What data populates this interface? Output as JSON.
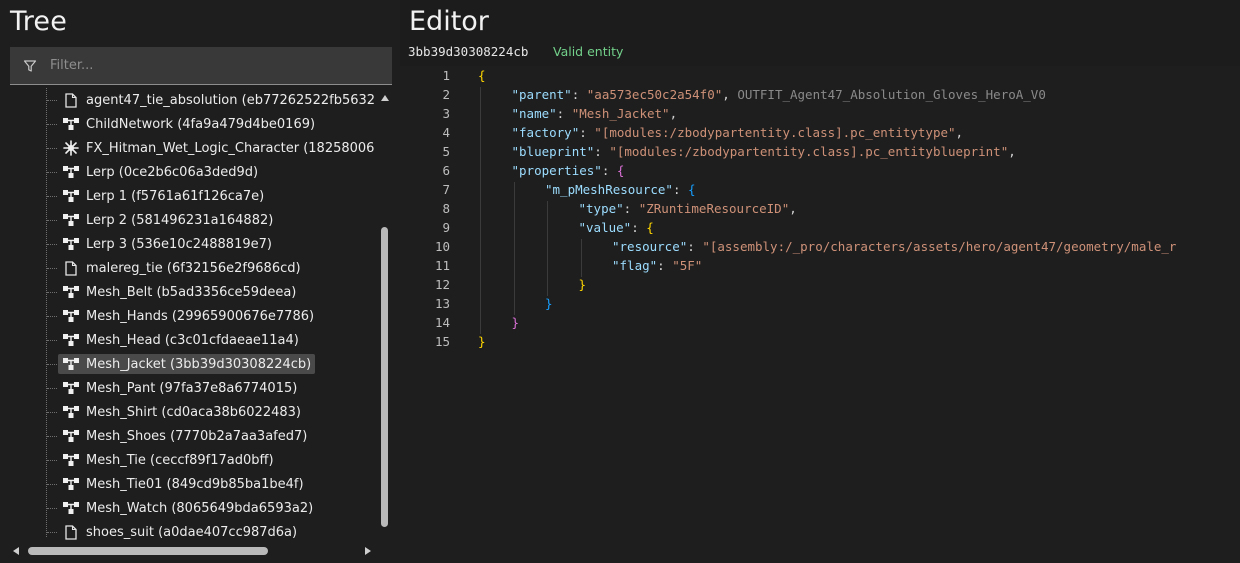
{
  "tree": {
    "title": "Tree",
    "filter_placeholder": "Filter...",
    "items": [
      {
        "label": "agent47_tie_absolution (eb77262522fb5632",
        "icon": "file-icon"
      },
      {
        "label": "ChildNetwork (4fa9a479d4be0169)",
        "icon": "network-icon"
      },
      {
        "label": "FX_Hitman_Wet_Logic_Character (18258006",
        "icon": "burst-icon"
      },
      {
        "label": "Lerp (0ce2b6c06a3ded9d)",
        "icon": "network-icon"
      },
      {
        "label": "Lerp 1 (f5761a61f126ca7e)",
        "icon": "network-icon"
      },
      {
        "label": "Lerp 2 (581496231a164882)",
        "icon": "network-icon"
      },
      {
        "label": "Lerp 3 (536e10c2488819e7)",
        "icon": "network-icon"
      },
      {
        "label": "malereg_tie (6f32156e2f9686cd)",
        "icon": "file-icon"
      },
      {
        "label": "Mesh_Belt (b5ad3356ce59deea)",
        "icon": "network-icon"
      },
      {
        "label": "Mesh_Hands (29965900676e7786)",
        "icon": "network-icon"
      },
      {
        "label": "Mesh_Head (c3c01cfdaeae11a4)",
        "icon": "network-icon"
      },
      {
        "label": "Mesh_Jacket (3bb39d30308224cb)",
        "icon": "network-icon",
        "selected": true
      },
      {
        "label": "Mesh_Pant (97fa37e8a6774015)",
        "icon": "network-icon"
      },
      {
        "label": "Mesh_Shirt (cd0aca38b6022483)",
        "icon": "network-icon"
      },
      {
        "label": "Mesh_Shoes (7770b2a7aa3afed7)",
        "icon": "network-icon"
      },
      {
        "label": "Mesh_Tie (ceccf89f17ad0bff)",
        "icon": "network-icon"
      },
      {
        "label": "Mesh_Tie01 (849cd9b85ba1be4f)",
        "icon": "network-icon"
      },
      {
        "label": "Mesh_Watch (8065649bda6593a2)",
        "icon": "network-icon"
      },
      {
        "label": "shoes_suit (a0dae407cc987d6a)",
        "icon": "file-icon"
      }
    ]
  },
  "editor": {
    "title": "Editor",
    "entity_id": "3bb39d30308224cb",
    "status": "Valid entity",
    "lines": [
      {
        "n": "1",
        "indent": 0,
        "guides": 0,
        "tokens": [
          {
            "t": "{",
            "c": "b1"
          }
        ]
      },
      {
        "n": "2",
        "indent": 1,
        "guides": 1,
        "tokens": [
          {
            "t": "\"parent\"",
            "c": "k"
          },
          {
            "t": ": ",
            "c": "p"
          },
          {
            "t": "\"aa573ec50c2a54f0\"",
            "c": "s"
          },
          {
            "t": ", ",
            "c": "p"
          },
          {
            "t": "OUTFIT_Agent47_Absolution_Gloves_HeroA_V0",
            "c": "c"
          }
        ]
      },
      {
        "n": "3",
        "indent": 1,
        "guides": 1,
        "tokens": [
          {
            "t": "\"name\"",
            "c": "k"
          },
          {
            "t": ": ",
            "c": "p"
          },
          {
            "t": "\"Mesh_Jacket\"",
            "c": "s"
          },
          {
            "t": ",",
            "c": "p"
          }
        ]
      },
      {
        "n": "4",
        "indent": 1,
        "guides": 1,
        "tokens": [
          {
            "t": "\"factory\"",
            "c": "k"
          },
          {
            "t": ": ",
            "c": "p"
          },
          {
            "t": "\"[modules:/zbodypartentity.class].pc_entitytype\"",
            "c": "s"
          },
          {
            "t": ",",
            "c": "p"
          }
        ]
      },
      {
        "n": "5",
        "indent": 1,
        "guides": 1,
        "tokens": [
          {
            "t": "\"blueprint\"",
            "c": "k"
          },
          {
            "t": ": ",
            "c": "p"
          },
          {
            "t": "\"[modules:/zbodypartentity.class].pc_entityblueprint\"",
            "c": "s"
          },
          {
            "t": ",",
            "c": "p"
          }
        ]
      },
      {
        "n": "6",
        "indent": 1,
        "guides": 1,
        "tokens": [
          {
            "t": "\"properties\"",
            "c": "k"
          },
          {
            "t": ": ",
            "c": "p"
          },
          {
            "t": "{",
            "c": "b2"
          }
        ]
      },
      {
        "n": "7",
        "indent": 2,
        "guides": 2,
        "tokens": [
          {
            "t": "\"m_pMeshResource\"",
            "c": "k"
          },
          {
            "t": ": ",
            "c": "p"
          },
          {
            "t": "{",
            "c": "b3"
          }
        ]
      },
      {
        "n": "8",
        "indent": 3,
        "guides": 3,
        "tokens": [
          {
            "t": "\"type\"",
            "c": "k"
          },
          {
            "t": ": ",
            "c": "p"
          },
          {
            "t": "\"ZRuntimeResourceID\"",
            "c": "s"
          },
          {
            "t": ",",
            "c": "p"
          }
        ]
      },
      {
        "n": "9",
        "indent": 3,
        "guides": 3,
        "tokens": [
          {
            "t": "\"value\"",
            "c": "k"
          },
          {
            "t": ": ",
            "c": "p"
          },
          {
            "t": "{",
            "c": "b1"
          }
        ]
      },
      {
        "n": "10",
        "indent": 4,
        "guides": 4,
        "tokens": [
          {
            "t": "\"resource\"",
            "c": "k"
          },
          {
            "t": ": ",
            "c": "p"
          },
          {
            "t": "\"[assembly:/_pro/characters/assets/hero/agent47/geometry/male_r",
            "c": "s"
          }
        ]
      },
      {
        "n": "11",
        "indent": 4,
        "guides": 4,
        "tokens": [
          {
            "t": "\"flag\"",
            "c": "k"
          },
          {
            "t": ": ",
            "c": "p"
          },
          {
            "t": "\"5F\"",
            "c": "s"
          }
        ]
      },
      {
        "n": "12",
        "indent": 3,
        "guides": 3,
        "tokens": [
          {
            "t": "}",
            "c": "b1"
          }
        ]
      },
      {
        "n": "13",
        "indent": 2,
        "guides": 2,
        "tokens": [
          {
            "t": "}",
            "c": "b3"
          }
        ]
      },
      {
        "n": "14",
        "indent": 1,
        "guides": 1,
        "tokens": [
          {
            "t": "}",
            "c": "b2"
          }
        ]
      },
      {
        "n": "15",
        "indent": 0,
        "guides": 0,
        "tokens": [
          {
            "t": "}",
            "c": "b1"
          }
        ]
      }
    ]
  },
  "colors": {
    "status_green": "#72d08a",
    "json_key": "#9cdcfe",
    "json_string": "#ce9178",
    "bracket_gold": "#ffd700",
    "bracket_purple": "#da70d6",
    "bracket_blue": "#179fff"
  }
}
